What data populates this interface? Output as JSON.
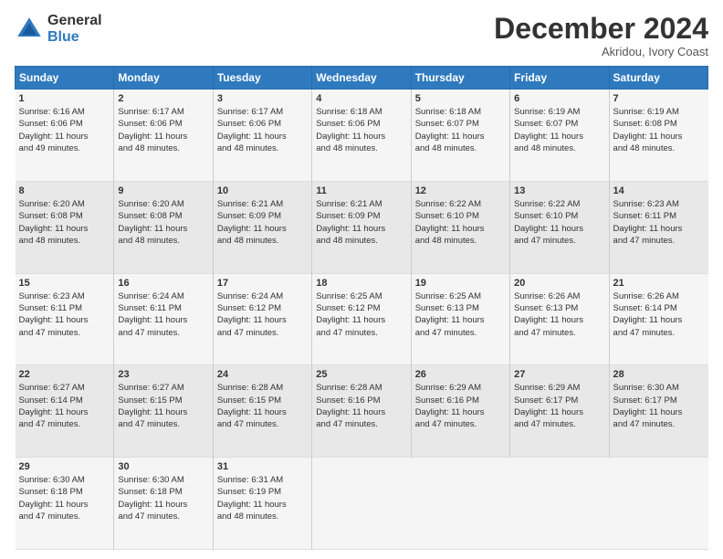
{
  "logo": {
    "general": "General",
    "blue": "Blue"
  },
  "title": "December 2024",
  "location": "Akridou, Ivory Coast",
  "header_days": [
    "Sunday",
    "Monday",
    "Tuesday",
    "Wednesday",
    "Thursday",
    "Friday",
    "Saturday"
  ],
  "weeks": [
    [
      {
        "day": "1",
        "text": "Sunrise: 6:16 AM\nSunset: 6:06 PM\nDaylight: 11 hours\nand 49 minutes."
      },
      {
        "day": "2",
        "text": "Sunrise: 6:17 AM\nSunset: 6:06 PM\nDaylight: 11 hours\nand 48 minutes."
      },
      {
        "day": "3",
        "text": "Sunrise: 6:17 AM\nSunset: 6:06 PM\nDaylight: 11 hours\nand 48 minutes."
      },
      {
        "day": "4",
        "text": "Sunrise: 6:18 AM\nSunset: 6:06 PM\nDaylight: 11 hours\nand 48 minutes."
      },
      {
        "day": "5",
        "text": "Sunrise: 6:18 AM\nSunset: 6:07 PM\nDaylight: 11 hours\nand 48 minutes."
      },
      {
        "day": "6",
        "text": "Sunrise: 6:19 AM\nSunset: 6:07 PM\nDaylight: 11 hours\nand 48 minutes."
      },
      {
        "day": "7",
        "text": "Sunrise: 6:19 AM\nSunset: 6:08 PM\nDaylight: 11 hours\nand 48 minutes."
      }
    ],
    [
      {
        "day": "8",
        "text": "Sunrise: 6:20 AM\nSunset: 6:08 PM\nDaylight: 11 hours\nand 48 minutes."
      },
      {
        "day": "9",
        "text": "Sunrise: 6:20 AM\nSunset: 6:08 PM\nDaylight: 11 hours\nand 48 minutes."
      },
      {
        "day": "10",
        "text": "Sunrise: 6:21 AM\nSunset: 6:09 PM\nDaylight: 11 hours\nand 48 minutes."
      },
      {
        "day": "11",
        "text": "Sunrise: 6:21 AM\nSunset: 6:09 PM\nDaylight: 11 hours\nand 48 minutes."
      },
      {
        "day": "12",
        "text": "Sunrise: 6:22 AM\nSunset: 6:10 PM\nDaylight: 11 hours\nand 48 minutes."
      },
      {
        "day": "13",
        "text": "Sunrise: 6:22 AM\nSunset: 6:10 PM\nDaylight: 11 hours\nand 47 minutes."
      },
      {
        "day": "14",
        "text": "Sunrise: 6:23 AM\nSunset: 6:11 PM\nDaylight: 11 hours\nand 47 minutes."
      }
    ],
    [
      {
        "day": "15",
        "text": "Sunrise: 6:23 AM\nSunset: 6:11 PM\nDaylight: 11 hours\nand 47 minutes."
      },
      {
        "day": "16",
        "text": "Sunrise: 6:24 AM\nSunset: 6:11 PM\nDaylight: 11 hours\nand 47 minutes."
      },
      {
        "day": "17",
        "text": "Sunrise: 6:24 AM\nSunset: 6:12 PM\nDaylight: 11 hours\nand 47 minutes."
      },
      {
        "day": "18",
        "text": "Sunrise: 6:25 AM\nSunset: 6:12 PM\nDaylight: 11 hours\nand 47 minutes."
      },
      {
        "day": "19",
        "text": "Sunrise: 6:25 AM\nSunset: 6:13 PM\nDaylight: 11 hours\nand 47 minutes."
      },
      {
        "day": "20",
        "text": "Sunrise: 6:26 AM\nSunset: 6:13 PM\nDaylight: 11 hours\nand 47 minutes."
      },
      {
        "day": "21",
        "text": "Sunrise: 6:26 AM\nSunset: 6:14 PM\nDaylight: 11 hours\nand 47 minutes."
      }
    ],
    [
      {
        "day": "22",
        "text": "Sunrise: 6:27 AM\nSunset: 6:14 PM\nDaylight: 11 hours\nand 47 minutes."
      },
      {
        "day": "23",
        "text": "Sunrise: 6:27 AM\nSunset: 6:15 PM\nDaylight: 11 hours\nand 47 minutes."
      },
      {
        "day": "24",
        "text": "Sunrise: 6:28 AM\nSunset: 6:15 PM\nDaylight: 11 hours\nand 47 minutes."
      },
      {
        "day": "25",
        "text": "Sunrise: 6:28 AM\nSunset: 6:16 PM\nDaylight: 11 hours\nand 47 minutes."
      },
      {
        "day": "26",
        "text": "Sunrise: 6:29 AM\nSunset: 6:16 PM\nDaylight: 11 hours\nand 47 minutes."
      },
      {
        "day": "27",
        "text": "Sunrise: 6:29 AM\nSunset: 6:17 PM\nDaylight: 11 hours\nand 47 minutes."
      },
      {
        "day": "28",
        "text": "Sunrise: 6:30 AM\nSunset: 6:17 PM\nDaylight: 11 hours\nand 47 minutes."
      }
    ],
    [
      {
        "day": "29",
        "text": "Sunrise: 6:30 AM\nSunset: 6:18 PM\nDaylight: 11 hours\nand 47 minutes."
      },
      {
        "day": "30",
        "text": "Sunrise: 6:30 AM\nSunset: 6:18 PM\nDaylight: 11 hours\nand 47 minutes."
      },
      {
        "day": "31",
        "text": "Sunrise: 6:31 AM\nSunset: 6:19 PM\nDaylight: 11 hours\nand 48 minutes."
      },
      {
        "day": "",
        "text": ""
      },
      {
        "day": "",
        "text": ""
      },
      {
        "day": "",
        "text": ""
      },
      {
        "day": "",
        "text": ""
      }
    ]
  ]
}
